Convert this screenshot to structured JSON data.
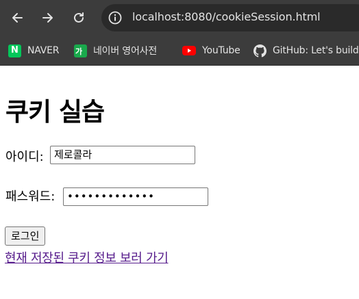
{
  "browser": {
    "url": "localhost:8080/cookieSession.html",
    "bookmarks": [
      {
        "label": "NAVER",
        "icon": "naver-icon"
      },
      {
        "label": "네이버 영어사전",
        "icon": "naver-dict-icon"
      },
      {
        "label": "YouTube",
        "icon": "youtube-icon"
      },
      {
        "label": "GitHub: Let's build",
        "icon": "github-icon"
      }
    ],
    "naver_icon_text": "N",
    "dict_icon_text": "가"
  },
  "page": {
    "title": "쿠키 실습",
    "id_label": "아이디:",
    "id_value": "제로콜라",
    "pw_label": "패스워드:",
    "pw_value": "•••••••••••••",
    "login_button": "로그인",
    "link_text": "현재 저장된 쿠키 정보 보러 가기"
  },
  "colors": {
    "toolbar": "#3c3c3c",
    "omnibox": "#2a2a2a",
    "link_visited": "#551a8b",
    "naver_green": "#03c75a",
    "youtube_red": "#ff0000"
  }
}
